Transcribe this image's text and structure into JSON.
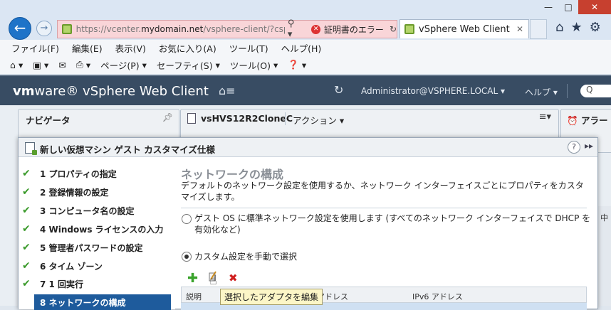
{
  "browser": {
    "window_controls": {
      "minimize": "—",
      "maximize": "□",
      "close": "✕"
    },
    "address": {
      "url_prefix": "https://vcenter.",
      "url_domain": "mydomain.net",
      "url_suffix": "/vsphere-client/?csp",
      "cert_error": "証明書のエラー"
    },
    "tab": {
      "title": "vSphere Web Client",
      "close": "✕"
    },
    "menu": [
      "ファイル(F)",
      "編集(E)",
      "表示(V)",
      "お気に入り(A)",
      "ツール(T)",
      "ヘルプ(H)"
    ],
    "command_bar": {
      "page": "ページ(P)",
      "safety": "セーフティ(S)",
      "tools": "ツール(O)"
    }
  },
  "vsphere": {
    "logo_vm": "vm",
    "logo_rest": "ware® vSphere Web Client",
    "user": "Administrator@VSPHERE.LOCAL ▾",
    "help": "ヘルプ ▾",
    "search": "Q"
  },
  "panels": {
    "navigator": "ナビゲータ",
    "vm_name": "vsHVS12R2CloneC",
    "actions": "アクション ▾",
    "alarms": "アラー"
  },
  "dialog": {
    "title": "新しい仮想マシン ゲスト カスタマイズ仕様",
    "help": "?",
    "expand": "▸▸",
    "steps": [
      {
        "label": "1  プロパティの指定",
        "done": true
      },
      {
        "label": "2  登録情報の設定",
        "done": true
      },
      {
        "label": "3  コンピュータ名の設定",
        "done": true
      },
      {
        "label": "4  Windows ライセンスの入力",
        "done": true
      },
      {
        "label": "5  管理者パスワードの設定",
        "done": true
      },
      {
        "label": "6  タイム ゾーン",
        "done": true
      },
      {
        "label": "7  1 回実行",
        "done": true
      },
      {
        "label": "8  ネットワークの構成",
        "done": false,
        "selected": true
      }
    ],
    "content": {
      "title": "ネットワークの構成",
      "description": "デフォルトのネットワーク設定を使用するか、ネットワーク インターフェイスごとにプロパティをカスタマイズします。",
      "option_standard": "ゲスト OS に標準ネットワーク設定を使用します (すべてのネットワーク インターフェイスで DHCP を有効化など)",
      "option_custom": "カスタム設定を手動で選択",
      "selected_option": "custom",
      "table_headers": [
        "説明",
        "アドレス",
        "IPv6 アドレス"
      ],
      "tooltip": "選択したアダプタを編集"
    }
  },
  "right_sliver": "中"
}
